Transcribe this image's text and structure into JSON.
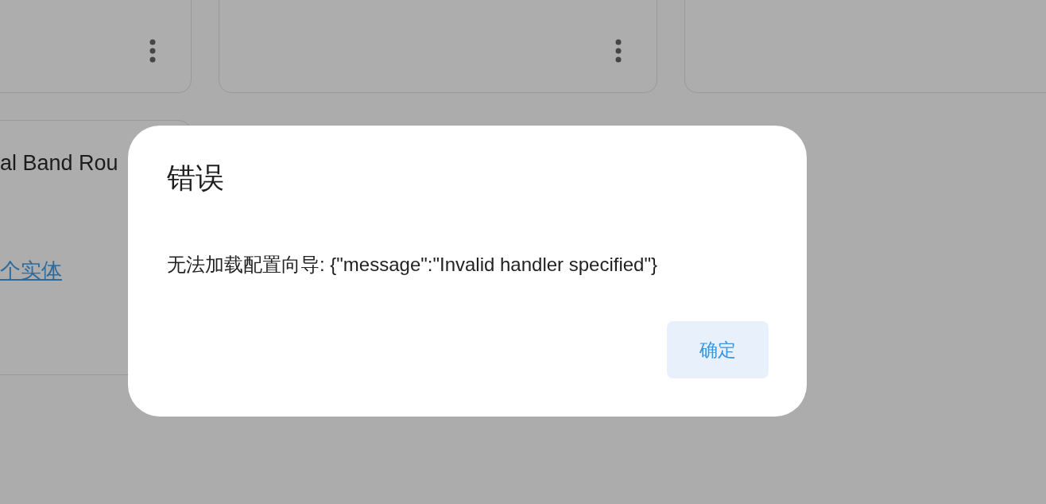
{
  "cards": [
    {
      "kind": "menu"
    },
    {
      "kind": "menu"
    },
    {
      "kind": "blank"
    },
    {
      "kind": "device",
      "title": "al Band Rou",
      "link": "个实体"
    }
  ],
  "dialog": {
    "title": "错误",
    "message": "无法加载配置向导: {\"message\":\"Invalid handler specified\"}",
    "buttons": [
      "确定"
    ]
  }
}
